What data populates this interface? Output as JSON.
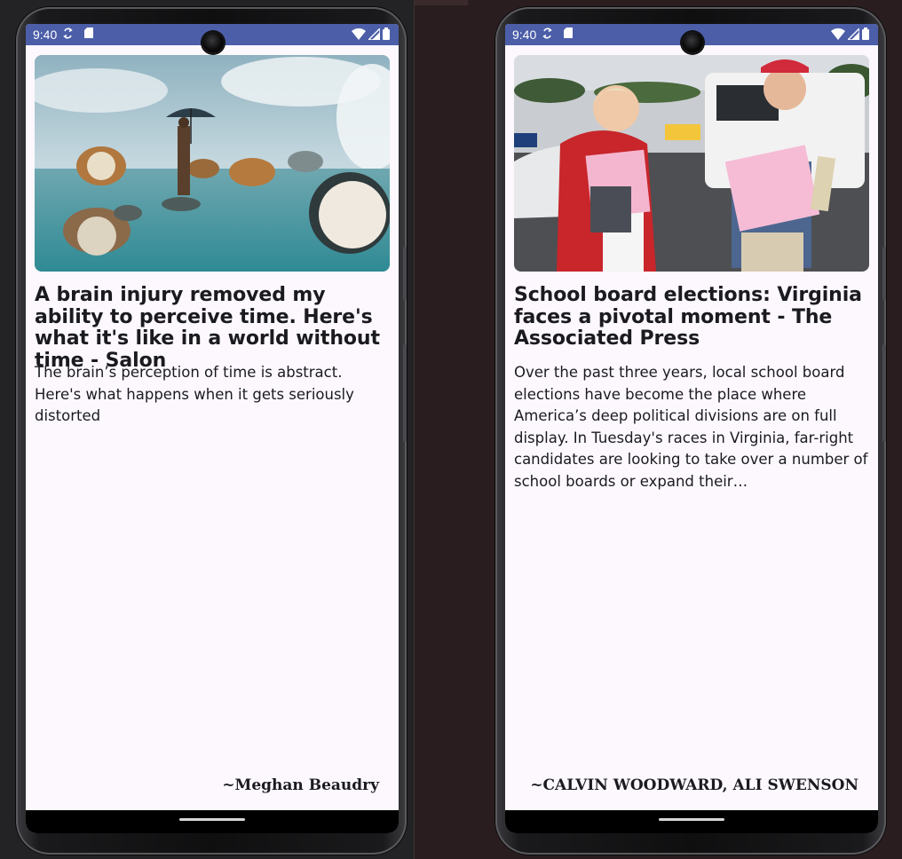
{
  "status_bar": {
    "time": "9:40"
  },
  "articles": [
    {
      "title": "A brain injury removed my ability to perceive time. Here's what it's like in a world without time - Salon",
      "description": "The brain’s perception of time is abstract. Here's what happens when it gets seriously distorted",
      "author": "~Meghan Beaudry",
      "image_desc": "surreal-clocks-in-sea-image"
    },
    {
      "title": "School board elections: Virginia faces a pivotal moment - The Associated Press",
      "description": "Over the past three years, local school board elections have become the place where America’s deep political divisions are on full display. In Tuesday's races in Virginia, far-right candidates are looking to take over a number of school boards or expand their…",
      "author": "~CALVIN WOODWARD, ALI SWENSON",
      "image_desc": "poll-workers-holding-ballots-image"
    }
  ],
  "colors": {
    "status_bar": "#4c5ea8",
    "screen_bg": "#fcf8fe",
    "text": "#1b1b1f"
  }
}
